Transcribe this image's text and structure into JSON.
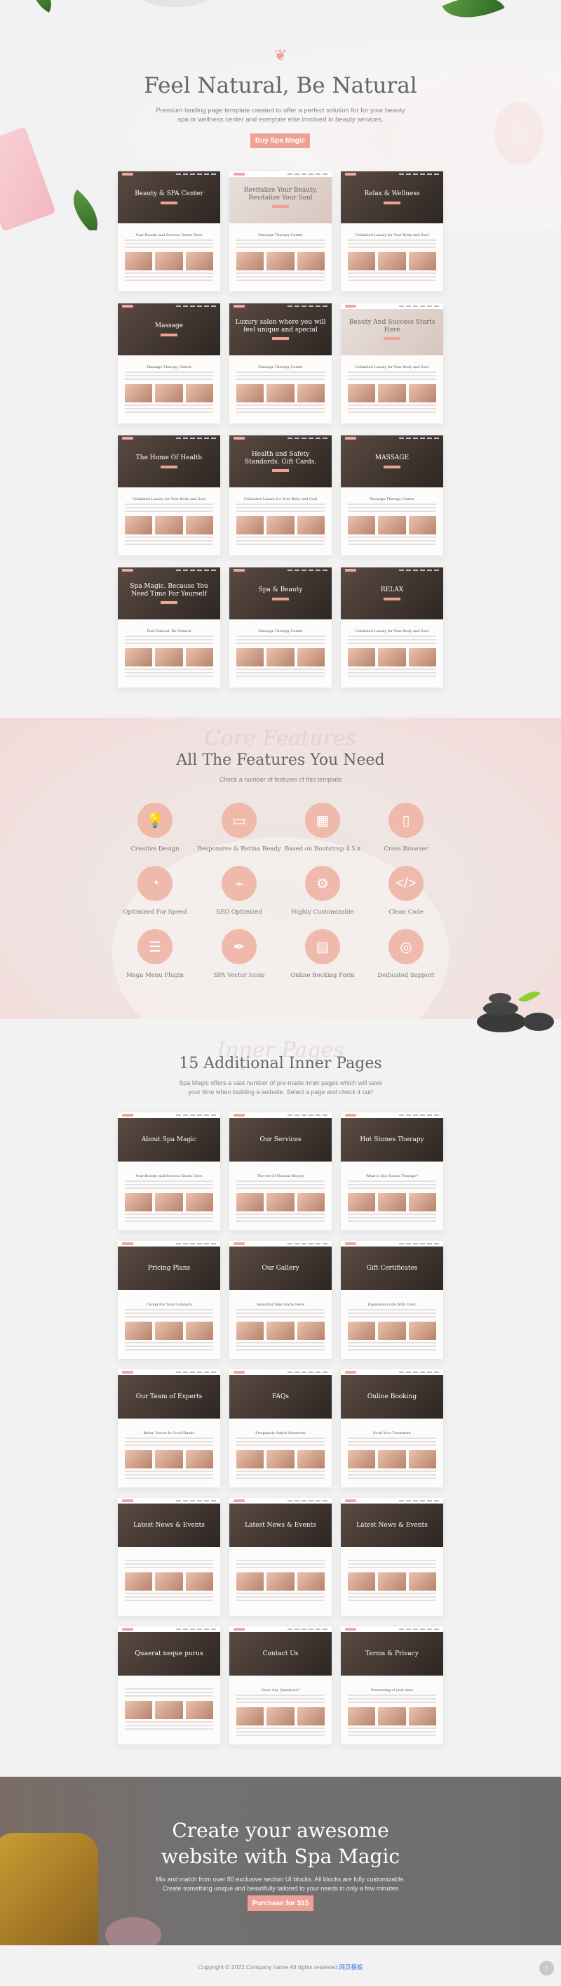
{
  "hero": {
    "title": "Feel Natural, Be Natural",
    "subtitle_line1": "Premium landing page template created to offer a perfect solution for for your beauty",
    "subtitle_line2": "spa or wellness center and everyone else involved in beauty services.",
    "button": "Buy Spa Magic",
    "accent": "#eea295"
  },
  "demos": [
    {
      "title": "Beauty & SPA Center",
      "section": "Your Beauty and Success Starts Here",
      "theme": "dark"
    },
    {
      "title": "Revitalize Your Beauty, Revitalize Your Soul",
      "section": "Massage Therapy Center",
      "theme": "light"
    },
    {
      "title": "Relax & Wellness",
      "section": "Unlimited Luxury for Your Body and Soul",
      "theme": "dark"
    },
    {
      "title": "Massage",
      "section": "Massage Therapy Center",
      "theme": "dark"
    },
    {
      "title": "Luxury salon where you will feel unique and special",
      "section": "Massage Therapy Center",
      "theme": "dark"
    },
    {
      "title": "Beauty And Success Starts Here",
      "section": "Unlimited Luxury for Your Body and Soul",
      "theme": "light"
    },
    {
      "title": "The Home Of Health",
      "section": "Unlimited Luxury for Your Body and Soul",
      "theme": "dark"
    },
    {
      "title": "Health and Safety Standards. Gift Cards.",
      "section": "Unlimited Luxury for Your Body and Soul",
      "theme": "dark"
    },
    {
      "title": "MASSAGE",
      "section": "Massage Therapy Center",
      "theme": "dark"
    },
    {
      "title": "Spa Magic. Because You Need Time For Yourself",
      "section": "Feel Natural, Be Natural",
      "theme": "dark"
    },
    {
      "title": "Spa & Beauty",
      "section": "Massage Therapy Center",
      "theme": "dark"
    },
    {
      "title": "RELAX",
      "section": "Unlimited Luxury for Your Body and Soul",
      "theme": "dark"
    }
  ],
  "features": {
    "watermark": "Core Features",
    "title": "All The Features You Need",
    "subtitle": "Check a number of features of this template",
    "items": [
      {
        "label": "Creative Design",
        "icon": "lightbulb-icon",
        "glyph": "💡"
      },
      {
        "label": "Responsive & Retina Ready",
        "icon": "browser-window-icon",
        "glyph": "▭"
      },
      {
        "label": "Based on Bootstrap 4.5.x",
        "icon": "layout-grid-icon",
        "glyph": "▦"
      },
      {
        "label": "Cross Browser",
        "icon": "devices-icon",
        "glyph": "▯"
      },
      {
        "label": "Optimized For Speed",
        "icon": "speedometer-icon",
        "glyph": "◔"
      },
      {
        "label": "SEO Optimized",
        "icon": "chart-monitor-icon",
        "glyph": "⌁"
      },
      {
        "label": "Highly Customizable",
        "icon": "gear-icon",
        "glyph": "⚙"
      },
      {
        "label": "Clean Code",
        "icon": "code-window-icon",
        "glyph": "</>"
      },
      {
        "label": "Mega Menu Plugin",
        "icon": "menu-icon",
        "glyph": "☰"
      },
      {
        "label": "SPA Vector Icons",
        "icon": "vector-pen-icon",
        "glyph": "✒"
      },
      {
        "label": "Online Booking Form",
        "icon": "calendar-icon",
        "glyph": "▤"
      },
      {
        "label": "Dedicated Support",
        "icon": "lifebuoy-icon",
        "glyph": "◎"
      }
    ]
  },
  "inner": {
    "watermark": "Inner Pages",
    "title": "15 Additional Inner Pages",
    "desc_line1": "Spa Magic offers a vast number of pre-made inner pages which will save",
    "desc_line2": "your time when building a website. Select a page and check it out!",
    "pages": [
      {
        "title": "About Spa Magic",
        "section": "Your Beauty and Success Starts Here"
      },
      {
        "title": "Our Services",
        "section": "The Art Of Natural Beauty"
      },
      {
        "title": "Hot Stones Therapy",
        "section": "What is Hot Stones Therapy?"
      },
      {
        "title": "Pricing Plans",
        "section": "Caring For Your Comforts"
      },
      {
        "title": "Our Gallery",
        "section": "Beautiful Skin Starts Here"
      },
      {
        "title": "Gift Certificates",
        "section": "Experience Life With Color"
      },
      {
        "title": "Our Team of Experts",
        "section": "Relax, You're In Good Hands"
      },
      {
        "title": "FAQs",
        "section": "Frequently Asked Questions"
      },
      {
        "title": "Online Booking",
        "section": "Book Your Treatment"
      },
      {
        "title": "Latest News & Events",
        "section": ""
      },
      {
        "title": "Latest News & Events",
        "section": ""
      },
      {
        "title": "Latest News & Events",
        "section": ""
      },
      {
        "title": "Quaerat neque purus",
        "section": ""
      },
      {
        "title": "Contact Us",
        "section": "Have Any Questions?"
      },
      {
        "title": "Terms & Privacy",
        "section": "Processing of your data"
      }
    ]
  },
  "cta": {
    "title_line1": "Create your awesome",
    "title_line2": "website with Spa Magic",
    "desc_line1": "Mix and match from over 80 exclusive section UI blocks. All blocks are fully customizable.",
    "desc_line2": "Create something unique and beautifully tailored to your needs in only a few minutes",
    "button": "Purchase for $15"
  },
  "footer": {
    "copyright": "Copyright © 2022.Company name All rights reserved.",
    "link": "网页模板",
    "back_to_top": "↑"
  }
}
